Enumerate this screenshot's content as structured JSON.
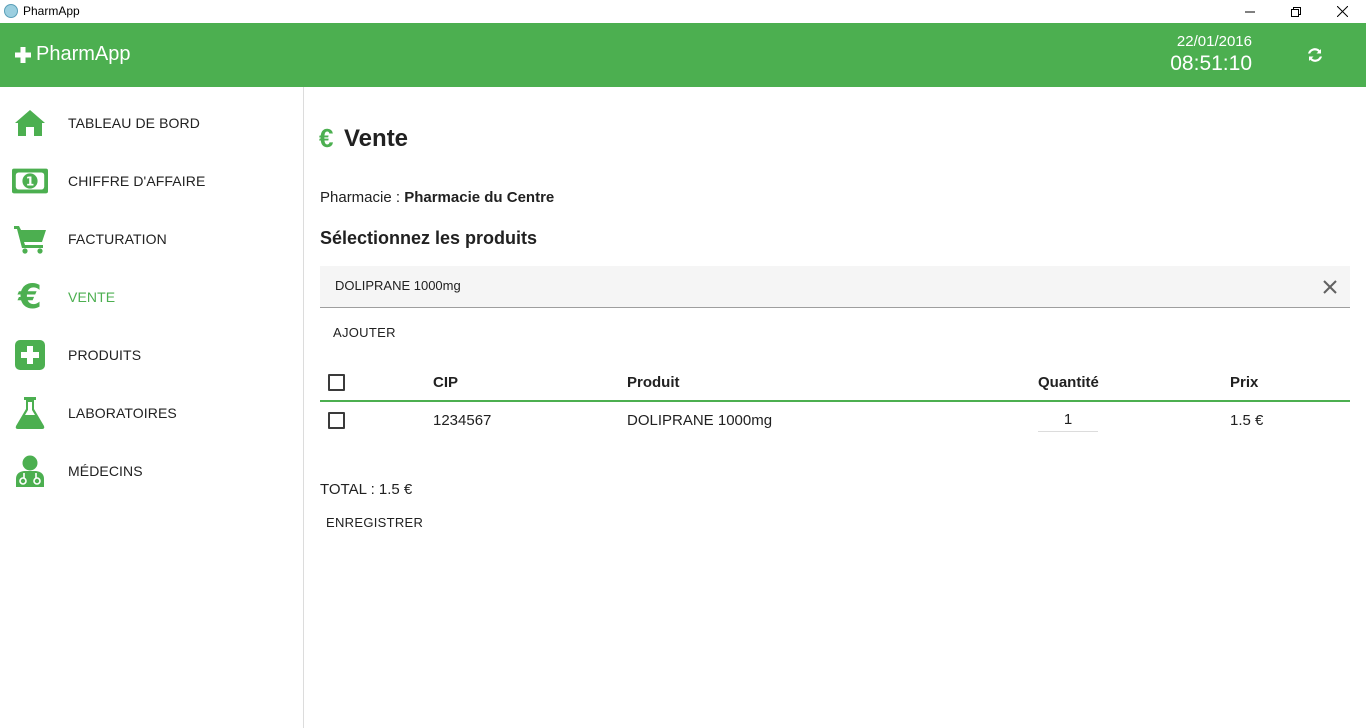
{
  "window": {
    "title": "PharmApp"
  },
  "header": {
    "brand": "PharmApp",
    "date": "22/01/2016",
    "time": "08:51:10",
    "color": "#4caf50"
  },
  "sidebar": {
    "items": [
      {
        "label": "TABLEAU DE BORD",
        "icon": "home-icon"
      },
      {
        "label": "CHIFFRE D'AFFAIRE",
        "icon": "banknote-icon"
      },
      {
        "label": "FACTURATION",
        "icon": "cart-icon"
      },
      {
        "label": "VENTE",
        "icon": "euro-icon",
        "active": true
      },
      {
        "label": "PRODUITS",
        "icon": "medical-plus-icon"
      },
      {
        "label": "LABORATOIRES",
        "icon": "flask-icon"
      },
      {
        "label": "MÉDECINS",
        "icon": "doctor-icon"
      }
    ]
  },
  "main": {
    "title": "Vente",
    "pharmacie_label": "Pharmacie : ",
    "pharmacie_value": "Pharmacie du Centre",
    "section_title": "Sélectionnez les produits",
    "search_value": "DOLIPRANE 1000mg",
    "add_button": "AJOUTER",
    "table": {
      "headers": [
        "CIP",
        "Produit",
        "Quantité",
        "Prix"
      ],
      "rows": [
        {
          "cip": "1234567",
          "produit": "DOLIPRANE 1000mg",
          "quantite": "1",
          "prix": "1.5 €"
        }
      ]
    },
    "total": "TOTAL : 1.5 €",
    "save_button": "ENREGISTRER"
  }
}
